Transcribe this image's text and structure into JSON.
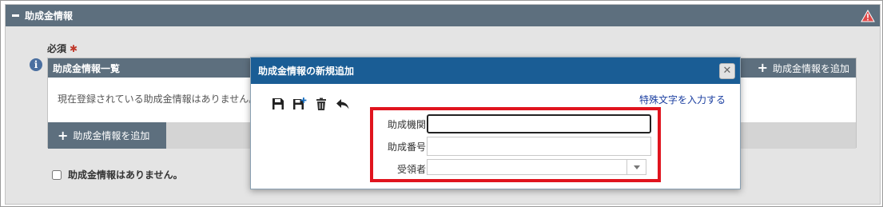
{
  "section": {
    "title": "助成金情報"
  },
  "required": {
    "label": "必須",
    "star": "✱"
  },
  "list": {
    "title": "助成金情報一覧",
    "add_label": "助成金情報を追加",
    "empty_message": "現在登録されている助成金情報はありません。",
    "footer_add_label": "助成金情報を追加"
  },
  "no_data": {
    "label": "助成金情報はありません。"
  },
  "dialog": {
    "title": "助成金情報の新規追加",
    "close_glyph": "✕",
    "special_chars_link": "特殊文字を入力する",
    "fields": {
      "agency_label": "助成機関:",
      "agency_value": "",
      "number_label": "助成番号:",
      "number_value": "",
      "recipient_label": "受領者:",
      "recipient_value": ""
    },
    "toolbar": [
      "save-icon",
      "save-add-icon",
      "trash-icon",
      "undo-icon"
    ]
  },
  "colors": {
    "header_bg": "#5d6f7e",
    "dialog_header_bg": "#1a5d95",
    "highlight": "#e0141e",
    "required_star": "#c0392b",
    "link": "#1a3ea0"
  }
}
